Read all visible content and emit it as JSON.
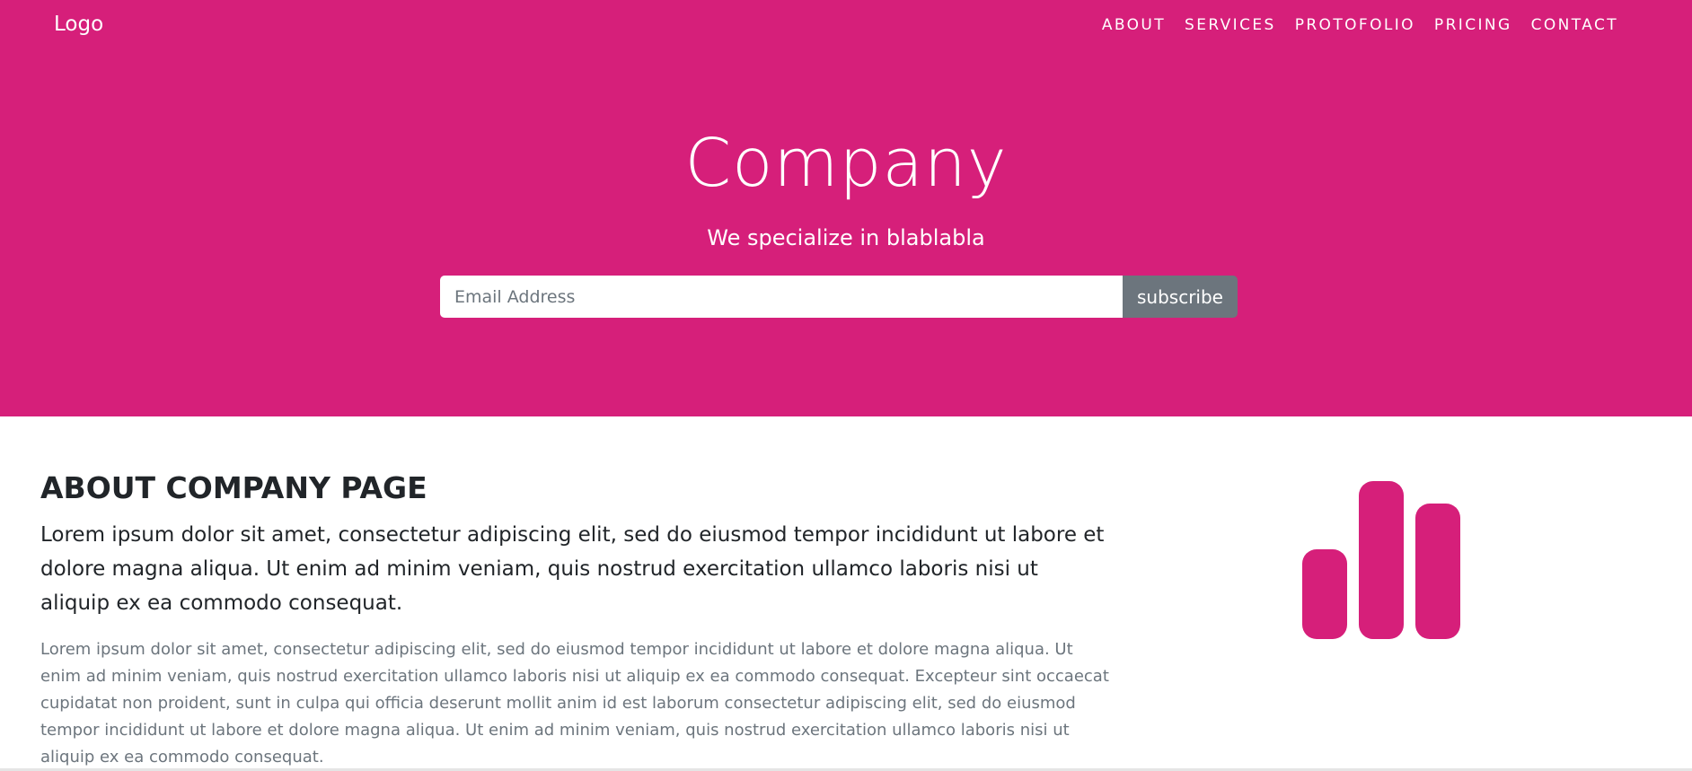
{
  "header": {
    "logo": "Logo",
    "nav": [
      "ABOUT",
      "SERVICES",
      "PROTOFOLIO",
      "PRICING",
      "CONTACT"
    ]
  },
  "hero": {
    "title": "Company",
    "subtitle": "We specialize in blablabla",
    "email_placeholder": "Email Address",
    "subscribe_label": "subscribe"
  },
  "about": {
    "title": "ABOUT COMPANY PAGE",
    "lead": "Lorem ipsum dolor sit amet, consectetur adipiscing elit, sed do eiusmod tempor incididunt ut labore et dolore magna aliqua. Ut enim ad minim veniam, quis nostrud exercitation ullamco laboris nisi ut aliquip ex ea commodo consequat.",
    "body": "Lorem ipsum dolor sit amet, consectetur adipiscing elit, sed do eiusmod tempor incididunt ut labore et dolore magna aliqua. Ut enim ad minim veniam, quis nostrud exercitation ullamco laboris nisi ut aliquip ex ea commodo consequat. Excepteur sint occaecat cupidatat non proident, sunt in culpa qui officia deserunt mollit anim id est laborum consectetur adipiscing elit, sed do eiusmod tempor incididunt ut labore et dolore magna aliqua. Ut enim ad minim veniam, quis nostrud exercitation ullamco laboris nisi ut aliquip ex ea commodo consequat.",
    "icon": "signal-bars-icon"
  },
  "colors": {
    "brand": "#d61f7a",
    "button": "#6c757d"
  }
}
